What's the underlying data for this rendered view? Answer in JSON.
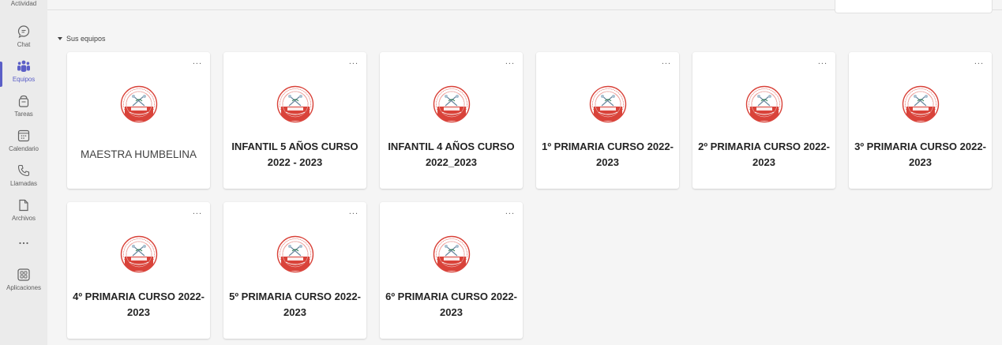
{
  "rail": {
    "top_label": "Actividad",
    "items": [
      {
        "label": "Chat",
        "icon": "chat-icon"
      },
      {
        "label": "Equipos",
        "icon": "teams-icon",
        "active": true
      },
      {
        "label": "Tareas",
        "icon": "assignments-icon"
      },
      {
        "label": "Calendario",
        "icon": "calendar-icon"
      },
      {
        "label": "Llamadas",
        "icon": "calls-icon"
      },
      {
        "label": "Archivos",
        "icon": "files-icon"
      },
      {
        "label": "",
        "icon": "more-icon"
      },
      {
        "label": "Aplicaciones",
        "icon": "apps-icon"
      }
    ],
    "accent_color": "#5b5fc7"
  },
  "section": {
    "label": "Sus equipos"
  },
  "teams": [
    {
      "name": "MAESTRA HUMBELINA",
      "more": "..."
    },
    {
      "name": "INFANTIL 5 AÑOS CURSO 2022 - 2023",
      "more": "..."
    },
    {
      "name": "INFANTIL 4 AÑOS CURSO 2022_2023",
      "more": "..."
    },
    {
      "name": "1º PRIMARIA CURSO 2022-2023",
      "more": "..."
    },
    {
      "name": "2º PRIMARIA CURSO 2022-2023",
      "more": "..."
    },
    {
      "name": "3º PRIMARIA CURSO 2022-2023",
      "more": "..."
    },
    {
      "name": "4º PRIMARIA CURSO 2022-2023",
      "more": "..."
    },
    {
      "name": "5º PRIMARIA CURSO 2022-2023",
      "more": "..."
    },
    {
      "name": "6º PRIMARIA CURSO 2022-2023",
      "more": "..."
    }
  ]
}
